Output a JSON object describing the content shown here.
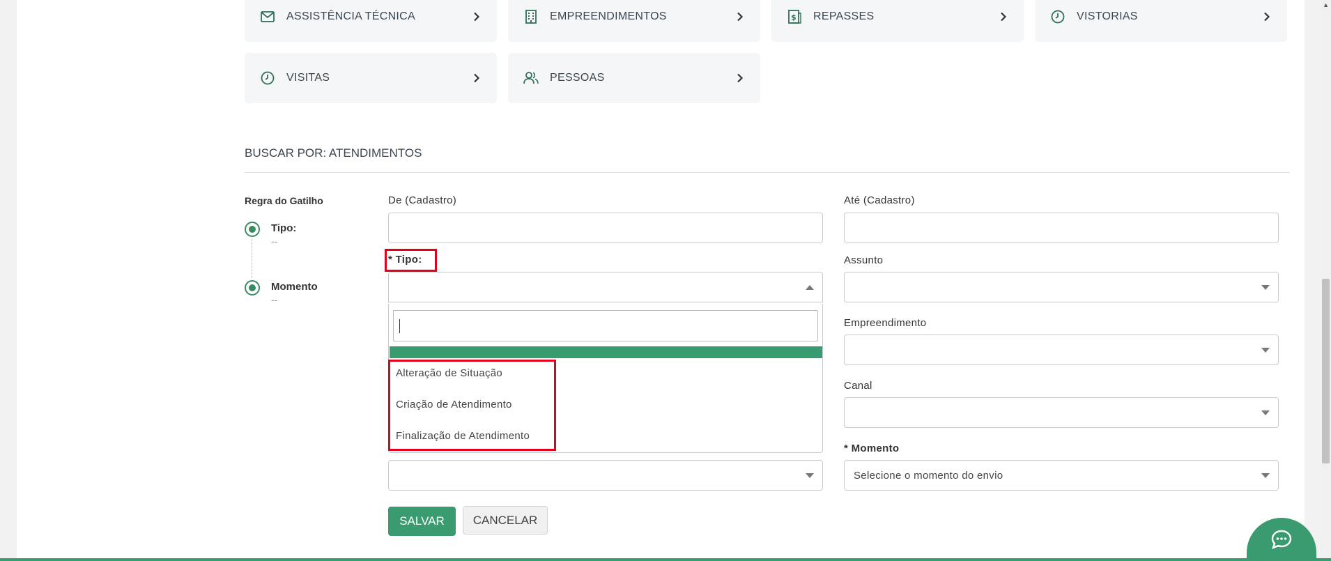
{
  "categories": [
    {
      "label": "ASSISTÊNCIA TÉCNICA",
      "icon": "envelope-icon"
    },
    {
      "label": "EMPREENDIMENTOS",
      "icon": "building-icon"
    },
    {
      "label": "REPASSES",
      "icon": "money-document-icon"
    },
    {
      "label": "VISTORIAS",
      "icon": "clock-icon"
    },
    {
      "label": "VISITAS",
      "icon": "clock-icon"
    },
    {
      "label": "PESSOAS",
      "icon": "people-icon"
    }
  ],
  "section_title": "BUSCAR POR: ATENDIMENTOS",
  "trigger_rule": {
    "title": "Regra do Gatilho",
    "steps": [
      {
        "name": "Tipo:",
        "value": "--"
      },
      {
        "name": "Momento",
        "value": "--"
      }
    ]
  },
  "form": {
    "de_label": "De (Cadastro)",
    "ate_label": "Até (Cadastro)",
    "tipo_label": "* Tipo:",
    "assunto_label": "Assunto",
    "empreendimento_label": "Empreendimento",
    "canal_label": "Canal",
    "momento_label": "* Momento",
    "momento_placeholder": "Selecione o momento do envio"
  },
  "tipo_dropdown": {
    "options": [
      "Alteração de Situação",
      "Criação de Atendimento",
      "Finalização de Atendimento"
    ]
  },
  "buttons": {
    "save": "SALVAR",
    "cancel": "CANCELAR"
  },
  "colors": {
    "accent": "#3a9b70",
    "highlight": "#e3001b",
    "icon": "#2f6f53"
  }
}
